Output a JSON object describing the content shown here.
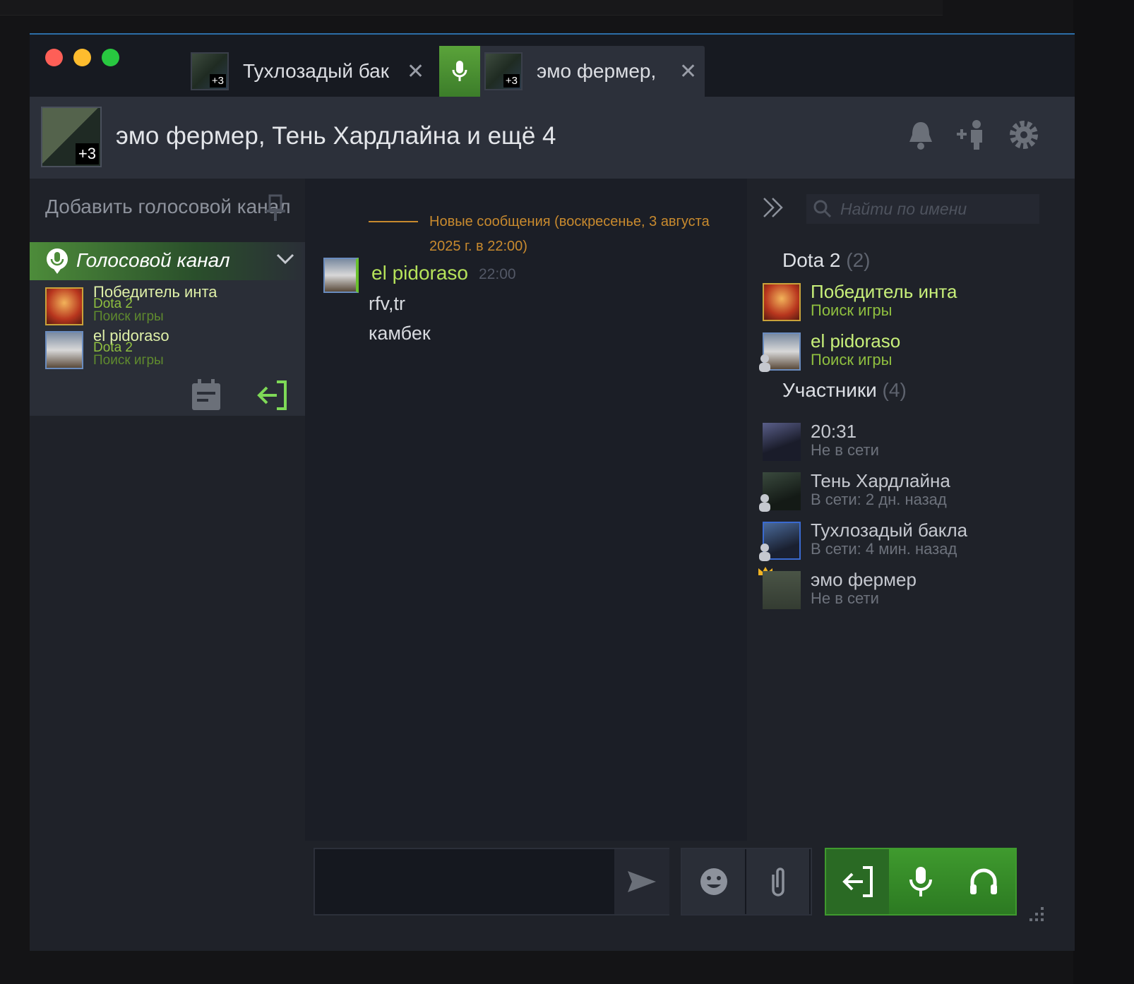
{
  "tabs": [
    {
      "title": "Тухлозадый бак",
      "badge": "+3",
      "close_icon": "close-icon"
    },
    {
      "title": "эмо фермер,",
      "badge": "+3",
      "close_icon": "close-icon",
      "voice_active": true
    }
  ],
  "header": {
    "title": "эмо фермер, Тень Хардлайна и ещё 4",
    "avatar_badge": "+3",
    "icons": [
      "bell-icon",
      "add-friend-icon",
      "gear-icon"
    ]
  },
  "left_panel": {
    "add_voice_label": "Добавить голосовой канал",
    "voice_channel": {
      "title": "Голосовой канал",
      "members": [
        {
          "name": "Победитель инта",
          "game": "Dota 2",
          "status": "Поиск игры"
        },
        {
          "name": "el pidoraso",
          "game": "Dota 2",
          "status": "Поиск игры"
        }
      ]
    }
  },
  "chat": {
    "new_messages_label": "Новые сообщения (воскресенье, 3 августа 2025 г. в 22:00)",
    "message": {
      "author": "el pidoraso",
      "time": "22:00",
      "lines": [
        "rfv,tr",
        "камбек"
      ]
    }
  },
  "members": {
    "search_placeholder": "Найти по имени",
    "groups": [
      {
        "title": "Dota 2",
        "count": "(2)",
        "members": [
          {
            "name": "Победитель инта",
            "status": "Поиск игры"
          },
          {
            "name": "el pidoraso",
            "status": "Поиск игры"
          }
        ]
      },
      {
        "title": "Участники",
        "count": "(4)",
        "members": [
          {
            "name": "20:31",
            "status": "Не в сети"
          },
          {
            "name": "Тень Хардлайна",
            "status": "В сети: 2 дн. назад"
          },
          {
            "name": "Тухлозадый бакла",
            "status": "В сети: 4 мин. назад"
          },
          {
            "name": "эмо фермер",
            "status": "Не в сети"
          }
        ]
      }
    ]
  },
  "colors": {
    "accent_green": "#4d8c3a",
    "ingame": "#8fbf3f",
    "new_messages": "#c88a2e"
  }
}
